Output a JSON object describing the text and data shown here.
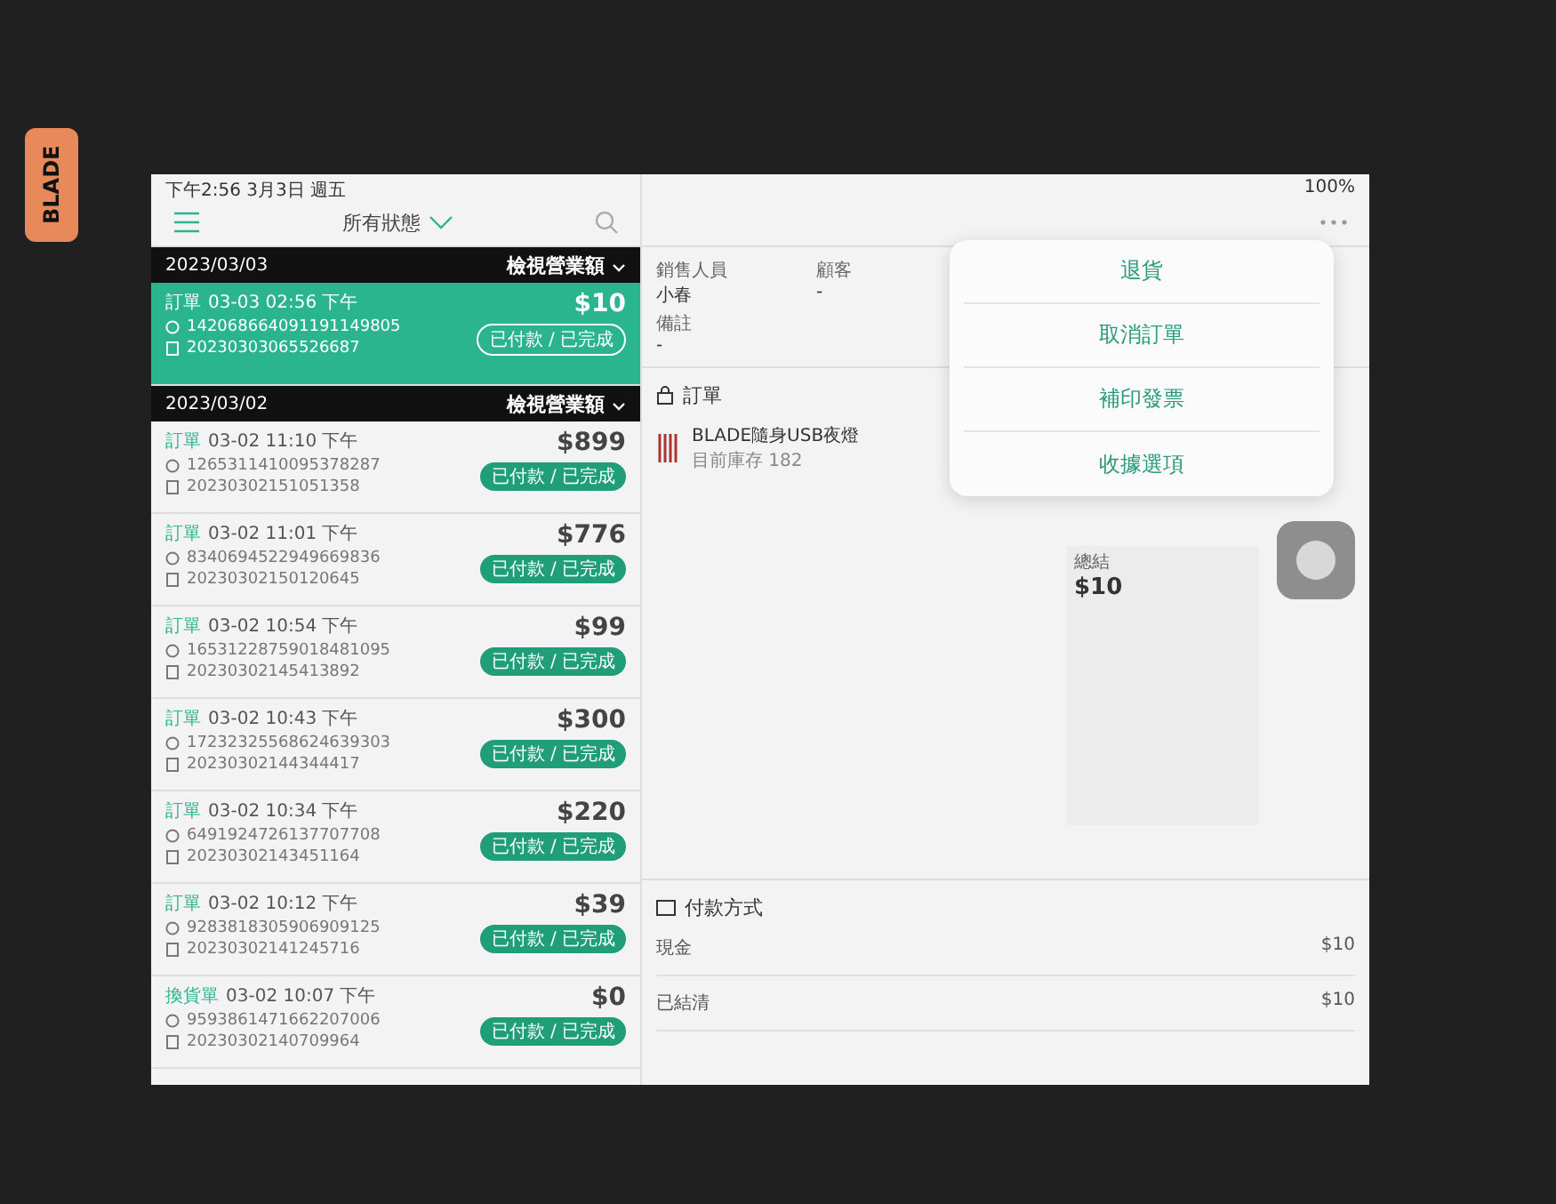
{
  "status_bar": {
    "time": "下午2:56  3月3日 週五",
    "battery": "100%"
  },
  "list": {
    "filter": "所有狀態",
    "groups": [
      {
        "date": "2023/03/03",
        "action": "檢視營業額",
        "orders": [
          {
            "type": "訂單",
            "time": "03-03 02:56 下午",
            "number": "142068664091191149805",
            "invoice": "20230303065526687",
            "amount": "$10",
            "status": "已付款 / 已完成",
            "selected": true
          }
        ]
      },
      {
        "date": "2023/03/02",
        "action": "檢視營業額",
        "orders": [
          {
            "type": "訂單",
            "time": "03-02 11:10 下午",
            "number": "1265311410095378287",
            "invoice": "20230302151051358",
            "amount": "$899",
            "status": "已付款 / 已完成",
            "selected": false
          },
          {
            "type": "訂單",
            "time": "03-02 11:01 下午",
            "number": "8340694522949669836",
            "invoice": "20230302150120645",
            "amount": "$776",
            "status": "已付款 / 已完成",
            "selected": false
          },
          {
            "type": "訂單",
            "time": "03-02 10:54 下午",
            "number": "16531228759018481095",
            "invoice": "20230302145413892",
            "amount": "$99",
            "status": "已付款 / 已完成",
            "selected": false
          },
          {
            "type": "訂單",
            "time": "03-02 10:43 下午",
            "number": "17232325568624639303",
            "invoice": "20230302144344417",
            "amount": "$300",
            "status": "已付款 / 已完成",
            "selected": false
          },
          {
            "type": "訂單",
            "time": "03-02 10:34 下午",
            "number": "6491924726137707708",
            "invoice": "20230302143451164",
            "amount": "$220",
            "status": "已付款 / 已完成",
            "selected": false
          },
          {
            "type": "訂單",
            "time": "03-02 10:12 下午",
            "number": "9283818305906909125",
            "invoice": "20230302141245716",
            "amount": "$39",
            "status": "已付款 / 已完成",
            "selected": false
          },
          {
            "type": "換貨單",
            "time": "03-02 10:07 下午",
            "number": "9593861471662207006",
            "invoice": "20230302140709964",
            "amount": "$0",
            "status": "已付款 / 已完成",
            "selected": false
          }
        ]
      }
    ]
  },
  "detail": {
    "fields": [
      {
        "label": "銷售人員",
        "value": "小春"
      },
      {
        "label": "顧客",
        "value": "-"
      },
      {
        "label": "備註",
        "value": "-"
      }
    ],
    "order_title": "訂單",
    "item": {
      "name": "BLADE隨身USB夜燈",
      "stock": "目前庫存 182"
    },
    "summary": {
      "label": "總結",
      "amount": "$10"
    },
    "payment_title": "付款方式",
    "payments": [
      {
        "label": "現金",
        "amount": "$10"
      },
      {
        "label": "已結清",
        "amount": "$10"
      }
    ]
  },
  "menu": [
    "退貨",
    "取消訂單",
    "補印發票",
    "收據選項"
  ],
  "case_label": "BLADE"
}
